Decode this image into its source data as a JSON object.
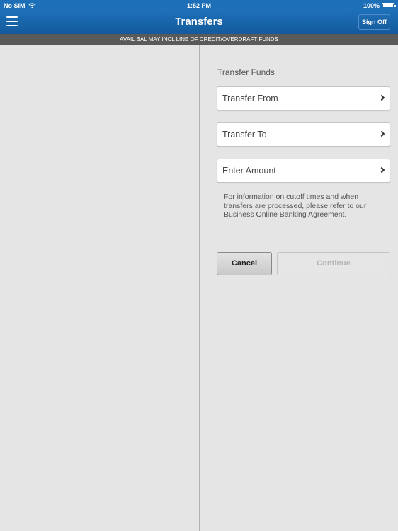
{
  "status_bar": {
    "carrier": "No SIM",
    "time": "1:52 PM",
    "battery": "100%",
    "icons": [
      "wifi-icon",
      "battery-icon"
    ]
  },
  "nav": {
    "title": "Transfers",
    "sign_off_label": "Sign Off",
    "menu_icon": "hamburger-menu-icon"
  },
  "banner": "AVAIL BAL MAY INCL LINE OF CREDIT/OVERDRAFT FUNDS",
  "form": {
    "section_title": "Transfer Funds",
    "rows": [
      {
        "label": "Transfer From"
      },
      {
        "label": "Transfer To"
      },
      {
        "label": "Enter Amount"
      }
    ],
    "info_text": "For information on cutoff times and when transfers are processed, please refer to our Business Online Banking Agreement.",
    "cancel_label": "Cancel",
    "continue_label": "Continue"
  },
  "colors": {
    "header_blue": "#1d6fb8",
    "banner_gray": "#5a5a5a",
    "background": "#e5e5e5",
    "disabled_text": "#b5b5b5"
  }
}
